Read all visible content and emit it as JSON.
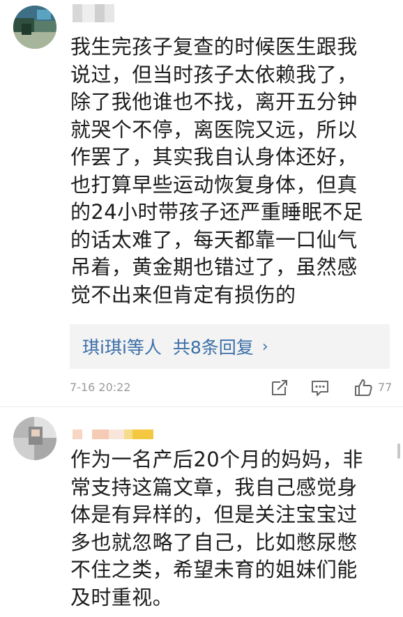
{
  "comments": [
    {
      "username": "",
      "text": "我生完孩子复查的时候医生跟我\n说过，但当时孩子太依赖我了，\n除了我他谁也不找，离开五分钟\n就哭个不停，离医院又远，所以\n作罢了，其实我自认身体还好，\n也打算早些运动恢复身体，但真\n的24小时带孩子还严重睡眠不足\n的话太难了，每天都靠一口仙气\n吊着，黄金期也错过了，虽然感\n觉不出来但肯定有损伤的",
      "replies": {
        "names": "琪i琪i等人",
        "count_label": "共8条回复",
        "chevron": "›"
      },
      "timestamp": "7-16 20:22",
      "likes": "77",
      "icons": {
        "share": "share-icon",
        "reply": "comment-icon",
        "like": "thumbs-up-icon"
      }
    },
    {
      "username": "",
      "text": "作为一名产后20个月的妈妈，非\n常支持这篇文章，我自己感觉身\n体是有异样的，但是关注宝宝过\n多也就忽略了自己，比如憋尿憋\n不住之类，希望未育的姐妹们能\n及时重视。"
    }
  ],
  "colors": {
    "link_blue": "#3b6fa8",
    "meta_gray": "#9a9a9a",
    "reply_box_bg": "#f3f3f3",
    "username_blur_yellow": "#f5c842",
    "username_blur_peach": "#f7d6c3"
  }
}
